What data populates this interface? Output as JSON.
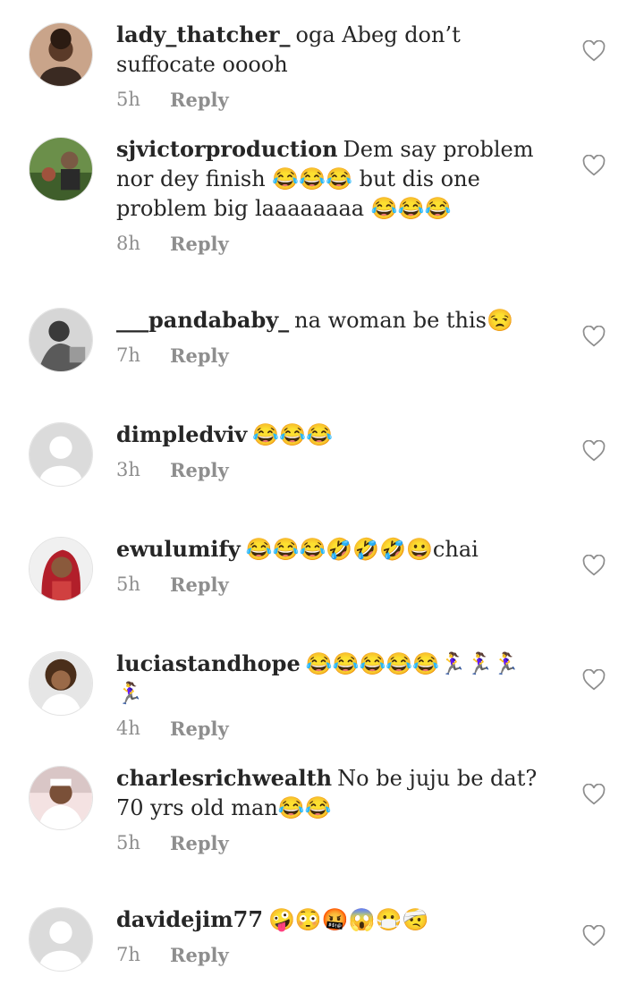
{
  "reply_label": "Reply",
  "comments": [
    {
      "username": "lady_thatcher_",
      "text": "oga Abeg don’t suffocate ooooh",
      "time": "5h"
    },
    {
      "username": "sjvictorproduction",
      "text": "Dem say problem nor dey finish 😂😂😂 but dis one problem big laaaaaaaa 😂😂😂",
      "time": "8h"
    },
    {
      "username": "___pandababy_",
      "text": "na woman be this😒",
      "time": "7h"
    },
    {
      "username": "dimpledviv",
      "text": "😂😂😂",
      "time": "3h"
    },
    {
      "username": "ewulumify",
      "text": "😂😂😂🤣🤣🤣😀chai",
      "time": "5h"
    },
    {
      "username": "luciastandhope",
      "text": "😂😂😂😂😂🏃‍♀️🏃‍♀️🏃‍♀️🏃‍♀️",
      "time": "4h"
    },
    {
      "username": "charlesrichwealth",
      "text": "No be juju be dat? 70 yrs old man😂😂",
      "time": "5h"
    },
    {
      "username": "davidejim77",
      "text": "🤪😳🤬😱😷🤕",
      "time": "7h"
    }
  ],
  "icons": {
    "like": "heart-outline-icon",
    "avatar_placeholder": "default-avatar-icon"
  },
  "colors": {
    "text": "#262626",
    "secondary": "#8e8e8e"
  }
}
